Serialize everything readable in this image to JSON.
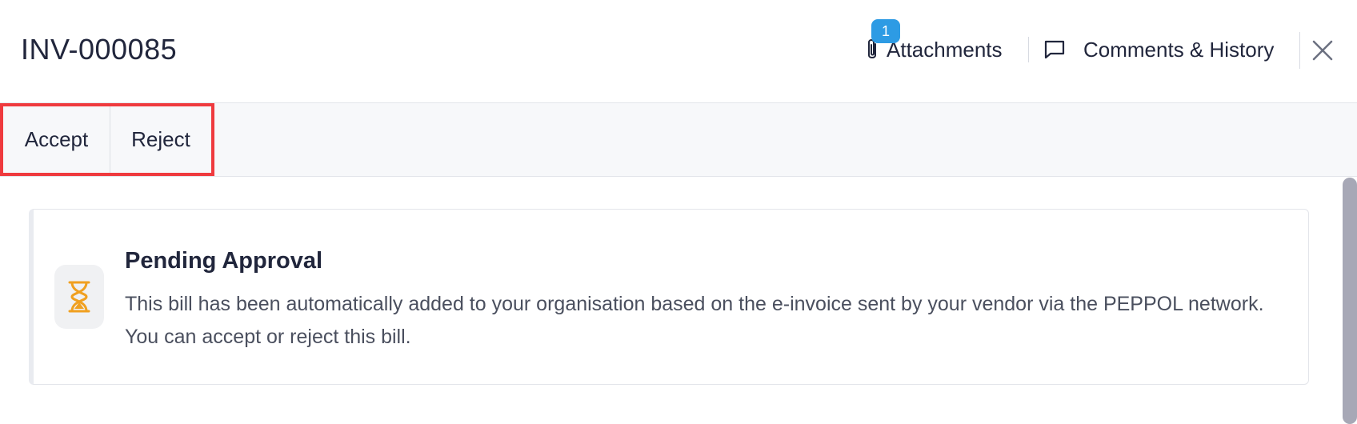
{
  "header": {
    "title": "INV-000085",
    "attachments": {
      "label": "Attachments",
      "count": "1",
      "icon": "paperclip-icon"
    },
    "comments": {
      "label": "Comments & History",
      "icon": "comment-bubble-icon"
    },
    "close_icon": "close-icon"
  },
  "toolbar": {
    "accept_label": "Accept",
    "reject_label": "Reject",
    "highlight_color": "#ef3a3e"
  },
  "status_banner": {
    "icon": "hourglass-icon",
    "icon_color": "#f0a020",
    "title": "Pending Approval",
    "message": "This bill has been automatically added to your organisation based on the e-invoice sent by your vendor via the PEPPOL network. You can accept or reject this bill."
  },
  "colors": {
    "badge": "#2d9be4",
    "text": "#21263c",
    "toolbar_bg": "#f7f8fa"
  }
}
